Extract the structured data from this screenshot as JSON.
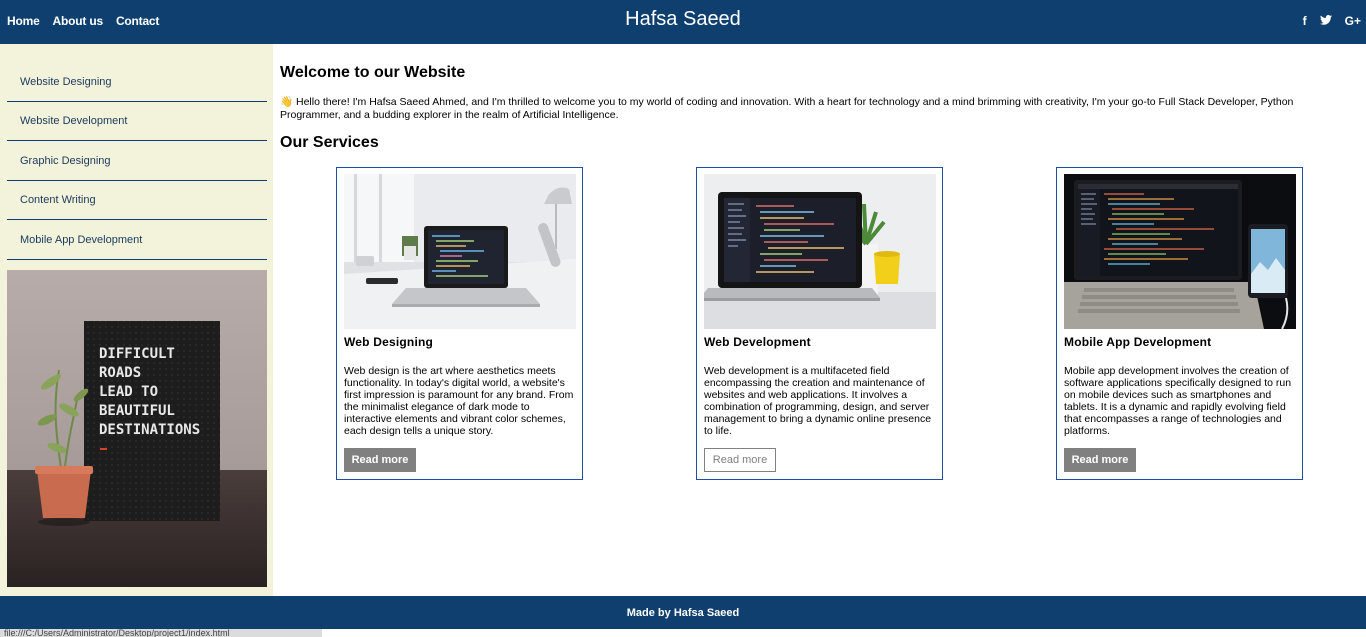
{
  "header": {
    "nav": [
      "Home",
      "About us",
      "Contact"
    ],
    "title": "Hafsa Saeed",
    "social": [
      {
        "icon": "facebook-icon",
        "glyph": "f"
      },
      {
        "icon": "twitter-icon",
        "glyph": "t"
      },
      {
        "icon": "google-plus-icon",
        "glyph": "G+"
      }
    ],
    "bg_color": "#0e3f6e"
  },
  "sidebar": {
    "items": [
      {
        "label": "Website Designing"
      },
      {
        "label": "Website Development"
      },
      {
        "label": "Graphic Designing"
      },
      {
        "label": "Content Writing"
      },
      {
        "label": "Mobile App Development"
      }
    ],
    "image_text": [
      "DIFFICULT",
      "ROADS",
      "LEAD TO",
      "BEAUTIFUL",
      "DESTINATIONS"
    ],
    "bg_color": "#f3f3dc"
  },
  "main": {
    "welcome_title": "Welcome to our Website",
    "intro": "👋 Hello there! I'm Hafsa Saeed Ahmed, and I'm thrilled to welcome you to my world of coding and innovation. With a heart for technology and a mind brimming with creativity, I'm your go-to Full Stack Developer, Python Programmer, and a budding explorer in the realm of Artificial Intelligence.",
    "services_title": "Our Services",
    "cards": [
      {
        "title": "Web Designing",
        "desc": "Web design is the art where aesthetics meets functionality. In today's digital world, a website's first impression is paramount for any brand. From the minimalist elegance of dark mode to interactive elements and vibrant color schemes, each design tells a unique story.",
        "button": "Read more"
      },
      {
        "title": "Web Development",
        "desc": "Web development is a multifaceted field encompassing the creation and maintenance of websites and web applications. It involves a combination of programming, design, and server management to bring a dynamic online presence to life.",
        "button": "Read more"
      },
      {
        "title": "Mobile App Development",
        "desc": "Mobile app development involves the creation of software applications specifically designed to run on mobile devices such as smartphones and tablets. It is a dynamic and rapidly evolving field that encompasses a range of technologies and platforms.",
        "button": "Read more"
      }
    ]
  },
  "footer": {
    "text": "Made by Hafsa Saeed"
  },
  "statusbar": {
    "text": "file:///C:/Users/Administrator/Desktop/project1/index.html"
  }
}
